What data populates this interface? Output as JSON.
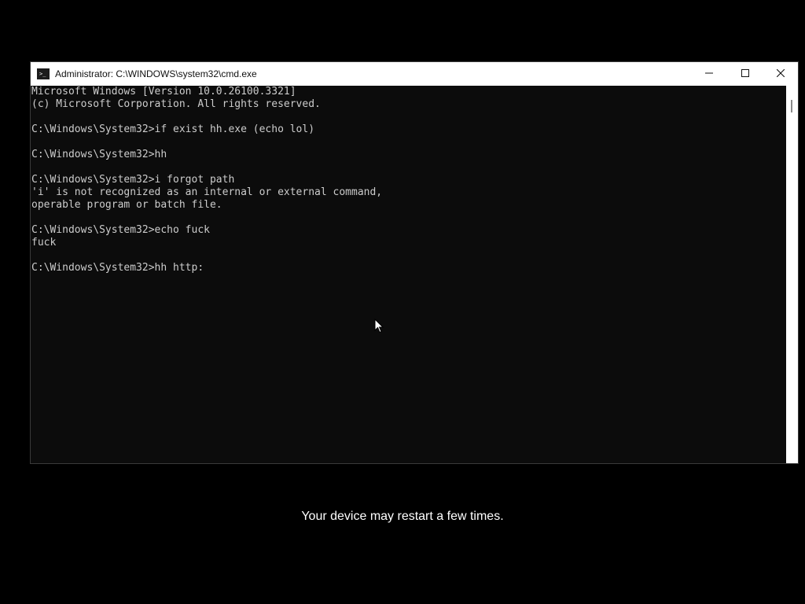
{
  "window": {
    "title": "Administrator: C:\\WINDOWS\\system32\\cmd.exe",
    "icon": "cmd-icon",
    "controls": [
      "minimize-icon",
      "maximize-icon",
      "close-icon"
    ]
  },
  "console": {
    "lines": [
      "Microsoft Windows [Version 10.0.26100.3321]",
      "(c) Microsoft Corporation. All rights reserved.",
      "",
      "C:\\Windows\\System32>if exist hh.exe (echo lol)",
      "",
      "C:\\Windows\\System32>hh",
      "",
      "C:\\Windows\\System32>i forgot path",
      "'i' is not recognized as an internal or external command,",
      "operable program or batch file.",
      "",
      "C:\\Windows\\System32>echo fuck",
      "fuck",
      "",
      "C:\\Windows\\System32>hh http:"
    ]
  },
  "status": {
    "message": "Your device may restart a few times."
  },
  "colors": {
    "screen_bg": "#000000",
    "console_bg": "#0c0c0c",
    "console_text": "#cccccc",
    "titlebar_bg": "#ffffff"
  }
}
